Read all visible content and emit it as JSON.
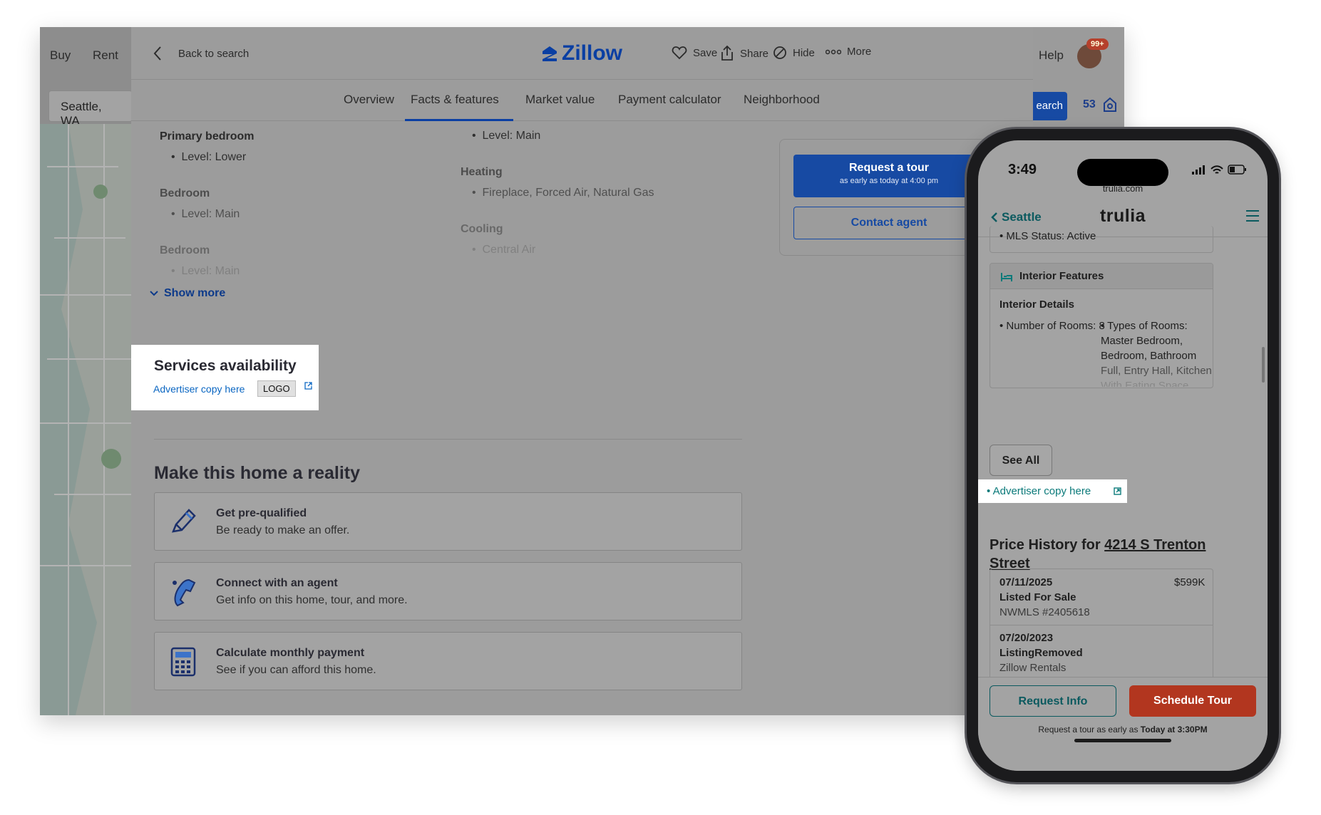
{
  "desktop": {
    "left_nav": {
      "buy": "Buy",
      "rent": "Rent",
      "location": "Seattle, WA"
    },
    "right_nav": {
      "help": "Help",
      "badge": "99+",
      "search_partial": "earch",
      "count": "53"
    },
    "top": {
      "back": "Back to search",
      "brand": "Zillow",
      "save": "Save",
      "share": "Share",
      "hide": "Hide",
      "more": "More"
    },
    "tabs": [
      "Overview",
      "Facts & features",
      "Market value",
      "Payment calculator",
      "Neighborhood"
    ],
    "active_tab": "Facts & features",
    "features": {
      "primary_bedroom": {
        "title": "Primary bedroom",
        "item": "Level: Lower"
      },
      "bedroom1": {
        "title": "Bedroom",
        "item": "Level: Main"
      },
      "bedroom2": {
        "title": "Bedroom",
        "item": "Level: Main"
      },
      "top_item": "Level: Main",
      "heating": {
        "title": "Heating",
        "item": "Fireplace, Forced Air, Natural Gas"
      },
      "cooling": {
        "title": "Cooling",
        "item": "Central Air"
      },
      "show_more": "Show more"
    },
    "tour_card": {
      "request_tour": "Request a tour",
      "request_sub": "as early as today at 4:00 pm",
      "contact_agent": "Contact agent"
    },
    "services": {
      "title": "Services availability",
      "advertiser": "Advertiser copy here",
      "logo": "LOGO"
    },
    "reality": {
      "title": "Make this home a reality",
      "cards": [
        {
          "title": "Get pre-qualified",
          "sub": "Be ready to make an offer.",
          "icon": "pencil-icon"
        },
        {
          "title": "Connect with an agent",
          "sub": "Get info on this home, tour, and more.",
          "icon": "phone-agent-icon"
        },
        {
          "title": "Calculate monthly payment",
          "sub": "See if you can afford this home.",
          "icon": "calculator-icon"
        }
      ]
    }
  },
  "phone": {
    "time": "3:49",
    "url": "trulia.com",
    "back": "Seattle",
    "brand": "trulia",
    "mls_status": "• MLS Status: Active",
    "interior": {
      "section": "Interior Features",
      "details_title": "Interior Details",
      "rooms": "• Number of Rooms: 8",
      "types_label": "• Types of Rooms:",
      "types_lines": [
        "Master Bedroom,",
        "Bedroom, Bathroom",
        "Full, Entry Hall, Kitchen",
        "With Eating Space"
      ],
      "see_all": "See All"
    },
    "advertiser": "• Advertiser copy here",
    "price_history": {
      "title_prefix": "Price History for",
      "address_line1": "4214 S Trenton",
      "address_line2": "Street",
      "rows": [
        {
          "date": "07/11/2025",
          "price": "$599K",
          "event": "Listed For Sale",
          "source": "NWMLS #2405618"
        },
        {
          "date": "07/20/2023",
          "price": "",
          "event": "ListingRemoved",
          "source": "Zillow Rentals"
        }
      ]
    },
    "bottom": {
      "request_info": "Request Info",
      "schedule_tour": "Schedule Tour",
      "note_prefix": "Request a tour as early as",
      "note_bold": "Today at 3:30PM"
    }
  }
}
